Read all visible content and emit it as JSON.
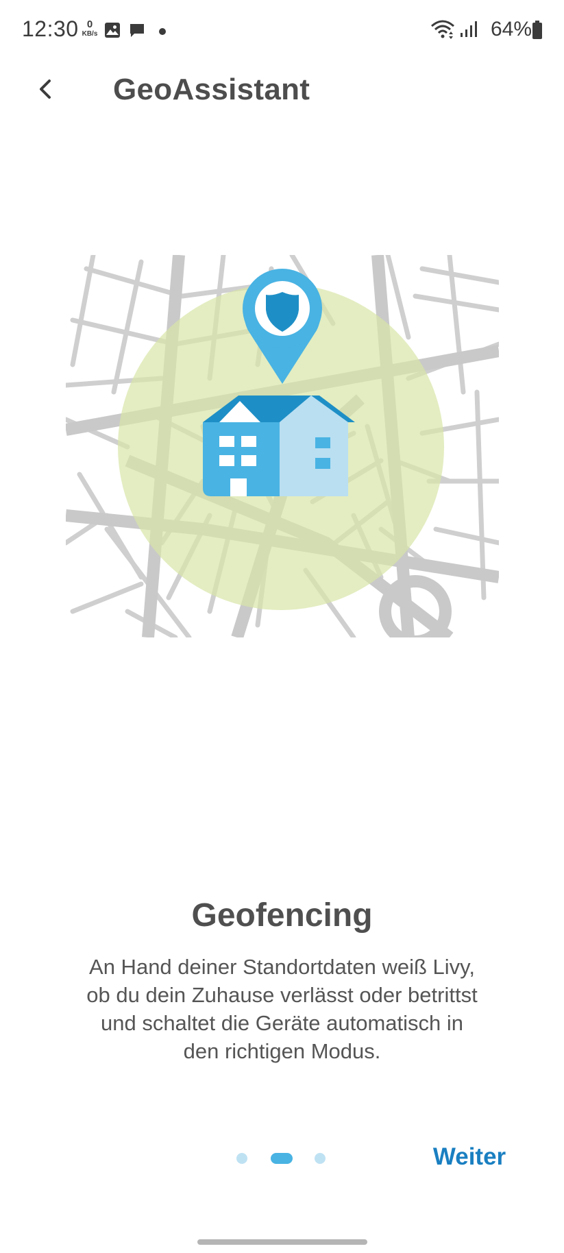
{
  "status_bar": {
    "time": "12:30",
    "net_speed_value": "0",
    "net_speed_unit": "KB/s",
    "battery_percent": "64%",
    "icons": [
      "image-icon",
      "message-icon",
      "notification-dot",
      "wifi-icon",
      "signal-icon",
      "battery-icon"
    ]
  },
  "app_bar": {
    "title": "GeoAssistant",
    "back_icon": "chevron-left-icon"
  },
  "onboarding": {
    "illustration": "map-geofence-house-illustration",
    "headline": "Geofencing",
    "body": "An Hand deiner Standortdaten weiß Livy, ob du dein Zuhause verlässt oder betrittst und schaltet die Geräte automatisch in den richtigen Modus."
  },
  "pager": {
    "page_count": 3,
    "current_page": 2
  },
  "actions": {
    "next_label": "Weiter"
  },
  "colors": {
    "accent": "#1a7fc1",
    "pin": "#49b3e3",
    "geofence": "#e3ecc4",
    "map_roads": "#cccccc",
    "house_dark": "#1e8fc6",
    "house_light": "#b9dff1"
  }
}
